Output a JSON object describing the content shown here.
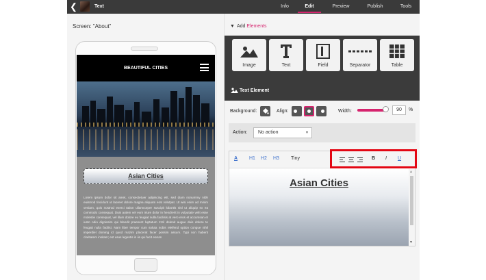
{
  "app": {
    "title": "Text"
  },
  "nav": {
    "tabs": [
      {
        "label": "Info",
        "active": false
      },
      {
        "label": "Edit",
        "active": true
      },
      {
        "label": "Preview",
        "active": false
      },
      {
        "label": "Publish",
        "active": false
      },
      {
        "label": "Tools",
        "active": false
      }
    ]
  },
  "left": {
    "screen_label": "Screen: \"About\"",
    "phone": {
      "site_title": "BEAUTIFUL CITIES",
      "heading": "Asian Cities",
      "body_text": "Lorem ipsum dolor sit amet, consectetuer adipiscing elit, sed diam nonummy nibh euismod tincidunt ut laoreet dolore magna aliquam erat volutpat. Ut wisi enim ad minim veniam, quis nostrud exerci tation ullamcorper suscipit lobortis nisl ut aliquip ex ea commodo consequat. Duis autem vel eum iriure dolor in hendrerit in vulputate velit esse molestie consequat, vel illum dolore eu feugiat nulla facilisis at vero eros et accumsan et iusto odio dignissim qui blandit praesent luptatum zzril delenit augue duis dolore te feugait nulla facilisi. Nam liber tempor cum soluta nobis eleifend option congue nihil imperdiet doming id quod mazim placerat facer possim assum. Typi non habent claritatem insitam; est usus legentis in iis qui facit eorum"
    }
  },
  "right": {
    "add_elements": {
      "prefix": "Add",
      "link": "Elements"
    },
    "element_buttons": [
      {
        "label": "Image",
        "icon": "image-icon"
      },
      {
        "label": "Text",
        "icon": "text-icon"
      },
      {
        "label": "Field",
        "icon": "field-icon"
      },
      {
        "label": "Separator",
        "icon": "separator-icon"
      },
      {
        "label": "Table",
        "icon": "table-icon"
      }
    ],
    "section_title": "Text Element",
    "props": {
      "background_label": "Background:",
      "align_label": "Align:",
      "align_selected": "center",
      "width_label": "Width:",
      "width_value": "90",
      "width_fraction": 0.9,
      "width_unit": "%"
    },
    "action": {
      "label": "Action:",
      "selected": "No action"
    },
    "editor": {
      "toolbar": {
        "color_label": "A",
        "h1": "H1",
        "h2": "H2",
        "h3": "H3",
        "tiny": "Tiny",
        "bold": "B",
        "italic": "I",
        "underline": "U"
      },
      "content": "Asian Cities"
    }
  },
  "colors": {
    "accent": "#d6246e",
    "topbar": "#3a3a3a",
    "highlight": "#e30613",
    "toolbar_link": "#3b6fcc"
  }
}
